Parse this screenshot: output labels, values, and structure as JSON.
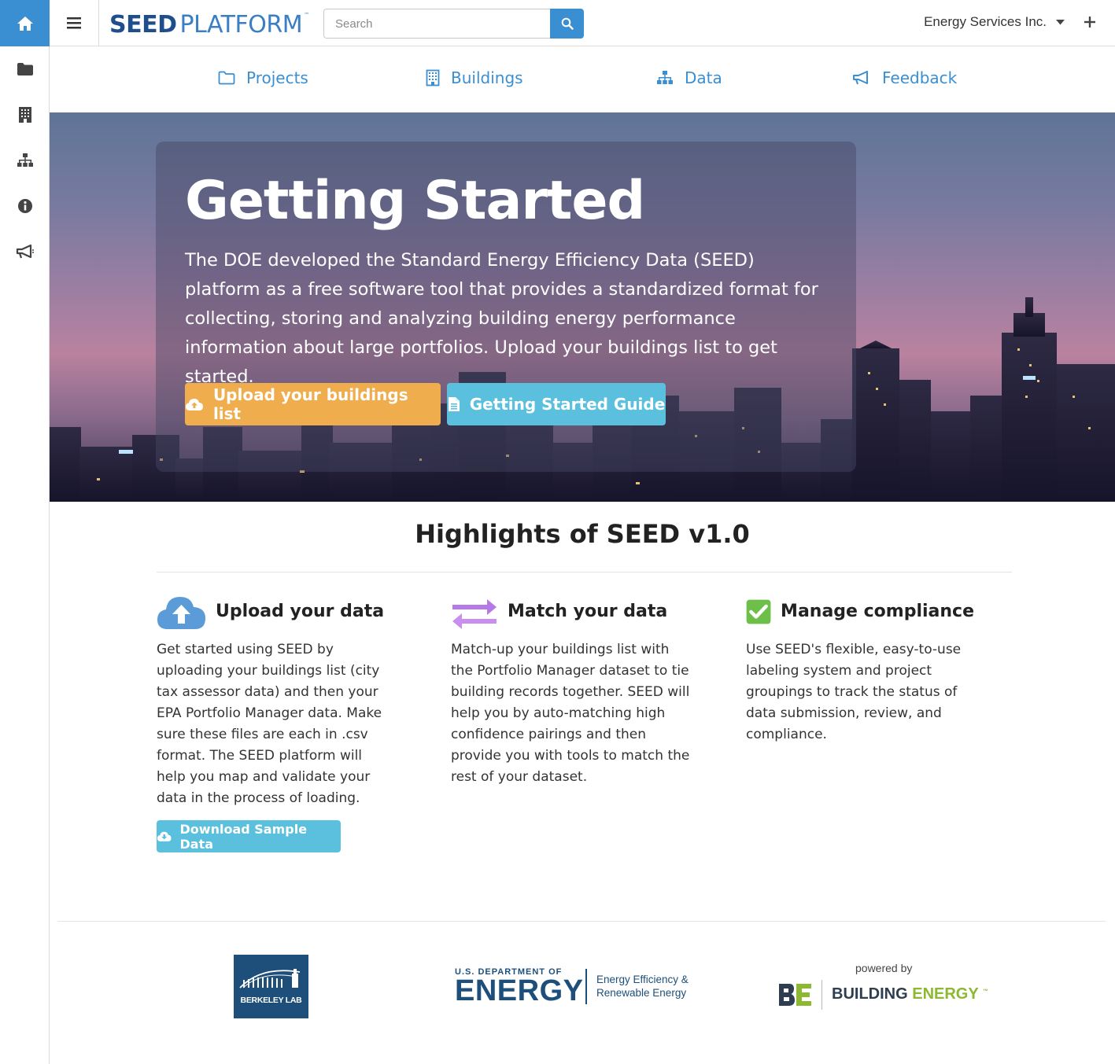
{
  "app": {
    "logo_bold": "SEED",
    "logo_light": "PLATFORM",
    "logo_tm": "™"
  },
  "topbar": {
    "search_placeholder": "Search",
    "organization": "Energy Services Inc."
  },
  "sidebar": {
    "items": [
      {
        "icon": "home-icon",
        "active": true
      },
      {
        "icon": "folder-icon"
      },
      {
        "icon": "building-icon"
      },
      {
        "icon": "sitemap-icon"
      },
      {
        "icon": "info-icon"
      },
      {
        "icon": "bullhorn-icon"
      }
    ]
  },
  "nav": {
    "items": [
      {
        "label": "Projects",
        "icon": "folder-open-icon"
      },
      {
        "label": "Buildings",
        "icon": "building-icon"
      },
      {
        "label": "Data",
        "icon": "sitemap-icon"
      },
      {
        "label": "Feedback",
        "icon": "bullhorn-icon"
      }
    ]
  },
  "hero": {
    "title": "Getting Started",
    "text": "The DOE developed the Standard Energy Efficiency Data (SEED) platform as a free software tool that provides a standardized format for collecting, storing and analyzing building energy performance information about large portfolios. Upload your buildings list to get started.",
    "upload_button": "Upload your buildings list",
    "guide_button": "Getting Started Guide"
  },
  "highlights": {
    "title": "Highlights of SEED v1.0",
    "columns": [
      {
        "icon": "cloud-upload-icon",
        "title": "Upload your data",
        "body": "Get started using SEED by uploading your buildings list (city tax assessor data) and then your EPA Portfolio Manager data. Make sure these files are each in .csv format. The SEED platform will help you map and validate your data in the process of loading.",
        "button": "Download Sample Data"
      },
      {
        "icon": "exchange-arrows-icon",
        "title": "Match your data",
        "body": "Match-up your buildings list with the Portfolio Manager dataset to tie building records together. SEED will help you by auto-matching high confidence pairings and then provide you with tools to match the rest of your dataset."
      },
      {
        "icon": "checkbox-icon",
        "title": "Manage compliance",
        "body": "Use SEED's flexible, easy-to-use labeling system and project groupings to track the status of data submission, review, and compliance."
      }
    ]
  },
  "footer": {
    "berkeley": "BERKELEY LAB",
    "doe_small": "U.S. DEPARTMENT OF",
    "doe_big": "ENERGY",
    "doe_line1": "Energy Efficiency &",
    "doe_line2": "Renewable Energy",
    "powered_by": "powered by",
    "be_word1": "BUILDING",
    "be_word2": "ENERGY",
    "be_tm": "™"
  },
  "colors": {
    "primary": "#3a8fd3",
    "warning": "#f0ad4e",
    "info": "#5bc0de",
    "brand_navy": "#1f4e8c",
    "success": "#5cb85c",
    "purple": "#b57ae8"
  }
}
